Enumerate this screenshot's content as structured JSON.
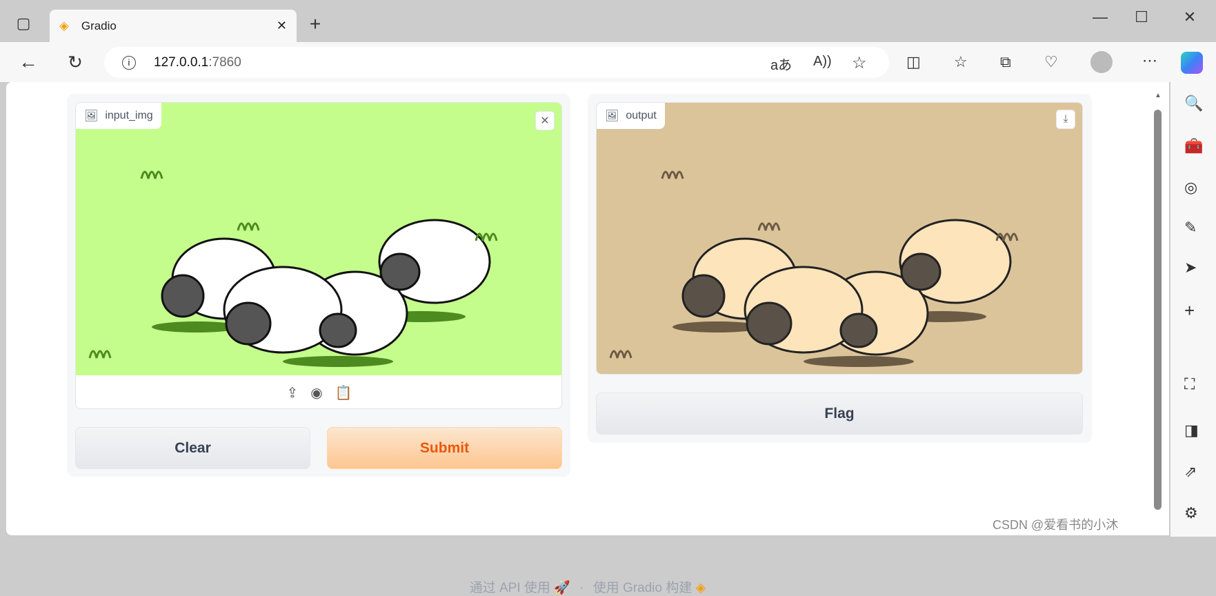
{
  "browser": {
    "tab_title": "Gradio",
    "url_host": "127.0.0.1",
    "url_port": ":7860"
  },
  "input": {
    "label": "input_img"
  },
  "output": {
    "label": "output"
  },
  "buttons": {
    "clear": "Clear",
    "submit": "Submit",
    "flag": "Flag"
  },
  "footer": {
    "api": "通过 API 使用",
    "separator": "·",
    "built": "使用 Gradio 构建"
  },
  "watermark": "CSDN @爱看书的小沐",
  "colors": {
    "input_bg": "#c4fd8c",
    "output_bg": "#dcc49a",
    "accent": "#ea580c"
  }
}
